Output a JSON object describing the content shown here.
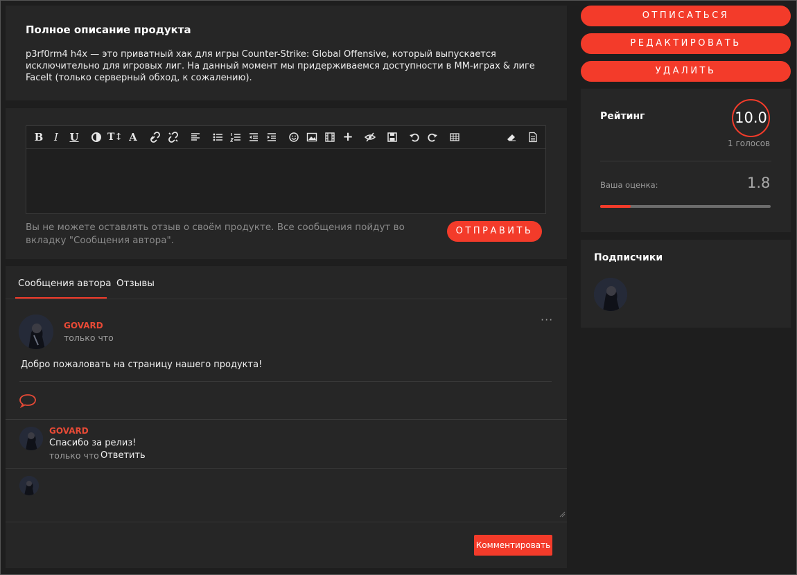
{
  "description": {
    "title": "Полное описание продукта",
    "text": "p3rf0rm4 h4x — это приватный хак для игры Counter-Strike: Global Offensive, который выпускается исключительно для игровых лиг. На данный момент мы придерживаемся доступности в ММ-играх & лиге FaceIt (только серверный обход, к сожалению)."
  },
  "review": {
    "note": "Вы не можете оставлять отзыв о своём продукте. Все сообщения пойдут во вкладку \"Сообщения автора\".",
    "send_label": "ОТПРАВИТЬ",
    "toolbar_icons": [
      "bold-icon",
      "italic-icon",
      "underline-icon",
      "contrast-icon",
      "text-size-icon",
      "font-color-icon",
      "link-icon",
      "unlink-icon",
      "align-icon",
      "bullet-list-icon",
      "numbered-list-icon",
      "outdent-icon",
      "indent-icon",
      "smiley-icon",
      "image-icon",
      "video-icon",
      "plus-icon",
      "hide-icon",
      "save-icon",
      "undo-icon",
      "redo-icon",
      "table-icon",
      "eraser-icon",
      "document-icon"
    ]
  },
  "tabs": [
    "Сообщения автора",
    "Отзывы"
  ],
  "post": {
    "author": "GOVARD",
    "time": "только что",
    "text": "Добро пожаловать на страницу нашего продукта!",
    "more": "···"
  },
  "reply": {
    "author": "GOVARD",
    "text": "Спасибо за релиз!",
    "time": "только что",
    "reply_label": "Ответить"
  },
  "comment_button": "Комментировать",
  "actions": {
    "unsubscribe": "ОТПИСАТЬСЯ",
    "edit": "РЕДАКТИРОВАТЬ",
    "delete": "УДАЛИТЬ"
  },
  "rating": {
    "title": "Рейтинг",
    "score": "10.0",
    "votes": "1 голосов",
    "your_label": "Ваша оценка:",
    "your_value": "1.8",
    "your_fraction": 0.18
  },
  "subscribers": {
    "title": "Подписчики"
  },
  "colors": {
    "accent": "#f33b2a",
    "panel": "#262626",
    "background": "#1e1e1e"
  }
}
